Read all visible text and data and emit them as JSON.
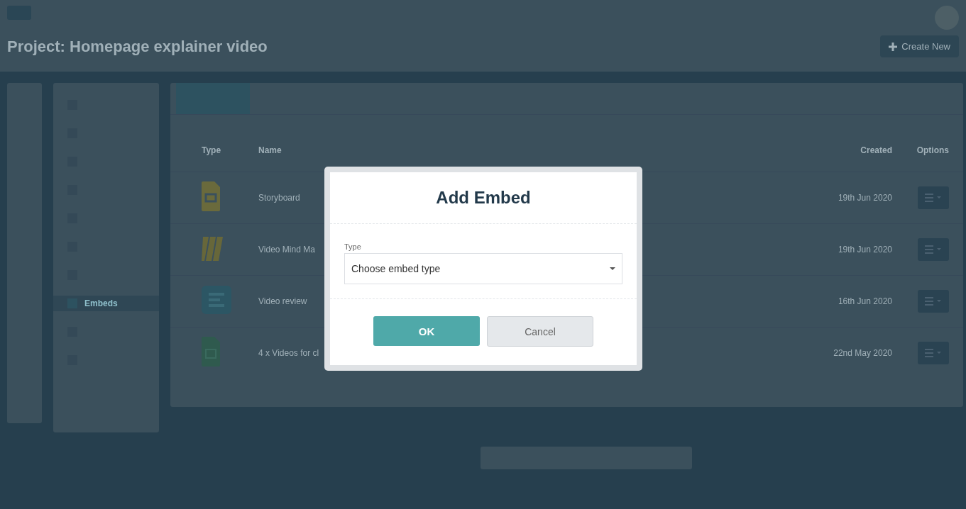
{
  "header": {
    "title": "Project: Homepage explainer video",
    "create_button": "Create New"
  },
  "sidebar": {
    "items": [
      {
        "kind": "blank",
        "selected": false
      },
      {
        "kind": "blank",
        "selected": false
      },
      {
        "kind": "blank",
        "selected": false
      },
      {
        "kind": "blank",
        "selected": false
      },
      {
        "kind": "blank",
        "selected": false
      },
      {
        "kind": "blank",
        "selected": false
      },
      {
        "kind": "blank",
        "selected": false
      },
      {
        "kind": "label",
        "label": "Embeds",
        "selected": true
      },
      {
        "kind": "blank",
        "selected": false
      },
      {
        "kind": "blank",
        "selected": false
      }
    ]
  },
  "table": {
    "columns": [
      "Type",
      "Name",
      "Created",
      "Options"
    ],
    "rows": [
      {
        "kind": "slides",
        "name": "Storyboard",
        "created": "19th Jun 2020"
      },
      {
        "kind": "board",
        "name": "Video Mind Ma",
        "created": "19th Jun 2020"
      },
      {
        "kind": "form",
        "name": "Video review",
        "created": "16th Jun 2020"
      },
      {
        "kind": "sheet",
        "name": "4 x Videos for cl",
        "created": "22nd May 2020"
      }
    ]
  },
  "dialog": {
    "title": "Add Embed",
    "field_label": "Type",
    "placeholder": "Choose embed type",
    "ok": "OK",
    "cancel": "Cancel"
  }
}
